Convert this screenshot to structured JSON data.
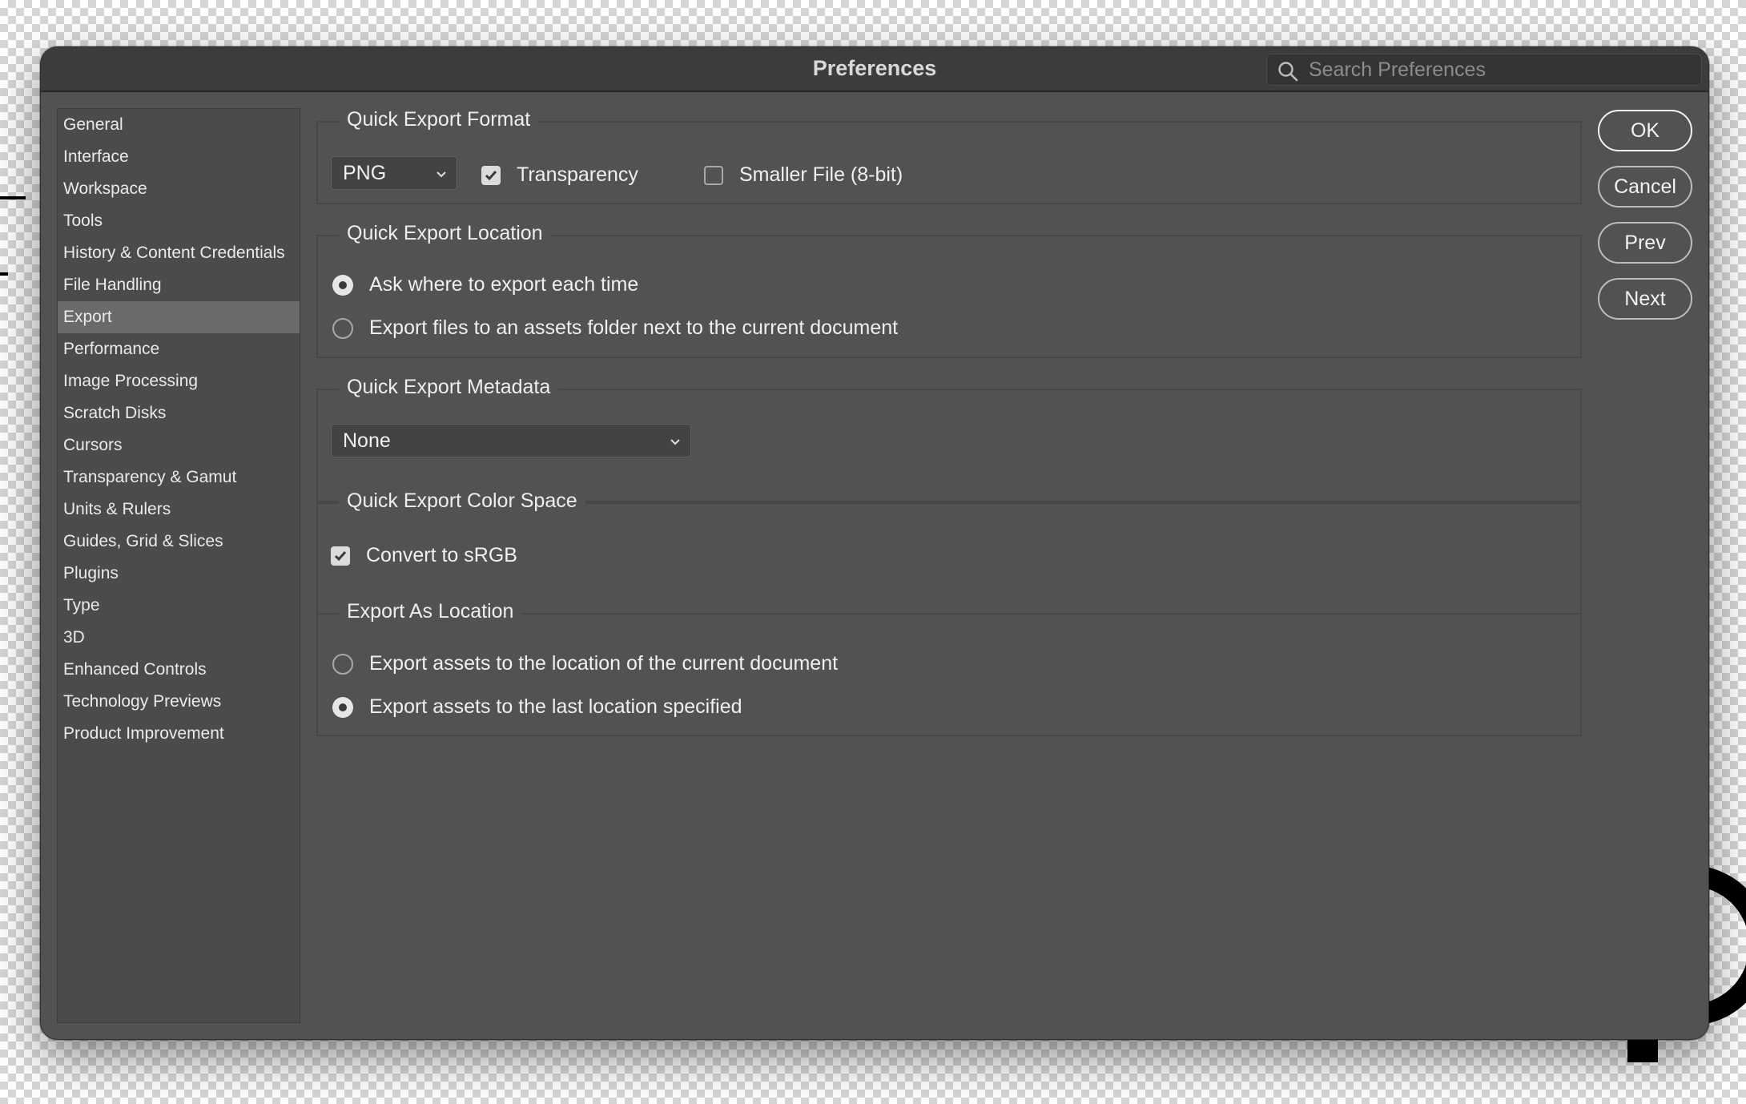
{
  "dialog": {
    "title": "Preferences"
  },
  "search": {
    "placeholder": "Search Preferences"
  },
  "sidebar": {
    "items": [
      {
        "label": "General"
      },
      {
        "label": "Interface"
      },
      {
        "label": "Workspace"
      },
      {
        "label": "Tools"
      },
      {
        "label": "History & Content Credentials"
      },
      {
        "label": "File Handling"
      },
      {
        "label": "Export",
        "active": true
      },
      {
        "label": "Performance"
      },
      {
        "label": "Image Processing"
      },
      {
        "label": "Scratch Disks"
      },
      {
        "label": "Cursors"
      },
      {
        "label": "Transparency & Gamut"
      },
      {
        "label": "Units & Rulers"
      },
      {
        "label": "Guides, Grid & Slices"
      },
      {
        "label": "Plugins"
      },
      {
        "label": "Type"
      },
      {
        "label": "3D"
      },
      {
        "label": "Enhanced Controls"
      },
      {
        "label": "Technology Previews"
      },
      {
        "label": "Product Improvement"
      }
    ]
  },
  "format": {
    "title": "Quick Export Format",
    "selected": "PNG",
    "transparency": {
      "label": "Transparency",
      "checked": true
    },
    "smaller_file": {
      "label": "Smaller File (8-bit)",
      "checked": false
    }
  },
  "location": {
    "title": "Quick Export Location",
    "options": [
      {
        "label": "Ask where to export each time",
        "selected": true
      },
      {
        "label": "Export files to an assets folder next to the current document",
        "selected": false
      }
    ]
  },
  "metadata": {
    "title": "Quick Export Metadata",
    "selected": "None"
  },
  "color_space": {
    "title": "Quick Export Color Space",
    "convert": {
      "label": "Convert to sRGB",
      "checked": true
    }
  },
  "export_as": {
    "title": "Export As Location",
    "options": [
      {
        "label": "Export assets to the location of the current document",
        "selected": false
      },
      {
        "label": "Export assets to the last location specified",
        "selected": true
      }
    ]
  },
  "buttons": {
    "ok": "OK",
    "cancel": "Cancel",
    "prev": "Prev",
    "next": "Next"
  }
}
